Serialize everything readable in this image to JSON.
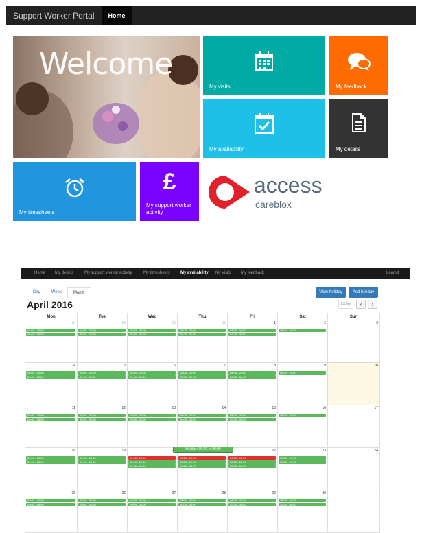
{
  "portal": {
    "brand": "Support Worker Portal",
    "nav_home": "Home",
    "welcome": "Welcome",
    "tiles": {
      "visits": "My visits",
      "feedback": "My feedback",
      "availability": "My availability",
      "details": "My details",
      "timesheets": "My timesheets",
      "activity": "My support worker activity"
    },
    "logo": {
      "name": "access",
      "sub": "careblox"
    },
    "colors": {
      "visits": "#00aaa5",
      "feedback": "#ff6b00",
      "availability": "#1ec0e8",
      "details": "#333333",
      "timesheets": "#2196df",
      "activity": "#7a00ff",
      "logo_red": "#e0202a"
    }
  },
  "calendar_app": {
    "nav": [
      "Home",
      "My details",
      "My support worker activity",
      "My timesheets",
      "My availability",
      "My visits",
      "My feedback"
    ],
    "nav_active": "My availability",
    "logout": "Logout",
    "view_tabs": [
      "Day",
      "Week",
      "Month"
    ],
    "active_view": "Month",
    "view_holiday": "View holiday",
    "add_holiday": "Add holiday",
    "title": "April 2016",
    "today_label": "today",
    "prev_icon": "‹",
    "next_icon": "›",
    "tooltip": "Holiday: 00:00 to 00:00",
    "day_headers": [
      "Mon",
      "Tue",
      "Wed",
      "Thu",
      "Fri",
      "Sat",
      "Sun"
    ],
    "weeks": [
      {
        "days": [
          {
            "n": "28",
            "other": true,
            "events": [
              {
                "t": "08:00 - 20:00",
                "c": "g"
              },
              {
                "t": "20:00 - 08:00",
                "c": "g"
              }
            ]
          },
          {
            "n": "29",
            "other": true,
            "events": [
              {
                "t": "08:00 - 20:00",
                "c": "g"
              },
              {
                "t": "20:00 - 08:00",
                "c": "g"
              }
            ]
          },
          {
            "n": "30",
            "other": true,
            "events": [
              {
                "t": "08:00 - 20:00",
                "c": "g"
              },
              {
                "t": "20:00 - 08:00",
                "c": "g"
              }
            ]
          },
          {
            "n": "31",
            "other": true,
            "events": [
              {
                "t": "08:00 - 20:00",
                "c": "g"
              },
              {
                "t": "20:00 - 08:00",
                "c": "g"
              }
            ]
          },
          {
            "n": "1",
            "events": [
              {
                "t": "08:00 - 20:00",
                "c": "g"
              },
              {
                "t": "20:00 - 08:00",
                "c": "g"
              }
            ]
          },
          {
            "n": "2",
            "events": [
              {
                "t": "08:00 - 20:00",
                "c": "g"
              }
            ]
          },
          {
            "n": "3",
            "events": []
          }
        ]
      },
      {
        "days": [
          {
            "n": "4",
            "events": [
              {
                "t": "08:00 - 20:00",
                "c": "g"
              },
              {
                "t": "20:00 - 08:00",
                "c": "g"
              }
            ]
          },
          {
            "n": "5",
            "events": [
              {
                "t": "08:00 - 20:00",
                "c": "g"
              },
              {
                "t": "20:00 - 08:00",
                "c": "g"
              }
            ]
          },
          {
            "n": "6",
            "events": [
              {
                "t": "08:00 - 20:00",
                "c": "g"
              },
              {
                "t": "20:00 - 08:00",
                "c": "g"
              }
            ]
          },
          {
            "n": "7",
            "events": [
              {
                "t": "08:00 - 20:00",
                "c": "g"
              },
              {
                "t": "20:00 - 08:00",
                "c": "g"
              }
            ]
          },
          {
            "n": "8",
            "events": [
              {
                "t": "08:00 - 20:00",
                "c": "g"
              },
              {
                "t": "20:00 - 08:00",
                "c": "g"
              }
            ]
          },
          {
            "n": "9",
            "events": [
              {
                "t": "08:00 - 20:00",
                "c": "g"
              }
            ]
          },
          {
            "n": "10",
            "today": true,
            "events": []
          }
        ]
      },
      {
        "days": [
          {
            "n": "11",
            "events": [
              {
                "t": "08:00 - 20:00",
                "c": "g"
              },
              {
                "t": "20:00 - 08:00",
                "c": "g"
              }
            ]
          },
          {
            "n": "12",
            "events": [
              {
                "t": "08:00 - 20:00",
                "c": "g"
              },
              {
                "t": "20:00 - 08:00",
                "c": "g"
              }
            ]
          },
          {
            "n": "13",
            "events": [
              {
                "t": "08:00 - 20:00",
                "c": "g"
              },
              {
                "t": "20:00 - 08:00",
                "c": "g"
              }
            ]
          },
          {
            "n": "14",
            "events": [
              {
                "t": "08:00 - 20:00",
                "c": "g"
              },
              {
                "t": "20:00 - 08:00",
                "c": "g"
              }
            ]
          },
          {
            "n": "15",
            "events": [
              {
                "t": "08:00 - 20:00",
                "c": "g"
              },
              {
                "t": "20:00 - 08:00",
                "c": "g"
              }
            ]
          },
          {
            "n": "16",
            "events": [
              {
                "t": "08:00 - 20:00",
                "c": "g"
              }
            ]
          },
          {
            "n": "17",
            "events": []
          }
        ]
      },
      {
        "days": [
          {
            "n": "18",
            "events": [
              {
                "t": "08:00 - 20:00",
                "c": "g"
              },
              {
                "t": "20:00 - 08:00",
                "c": "g"
              }
            ]
          },
          {
            "n": "19",
            "events": [
              {
                "t": "08:00 - 20:00",
                "c": "g"
              },
              {
                "t": "20:00 - 08:00",
                "c": "g"
              }
            ]
          },
          {
            "n": "20",
            "events": [
              {
                "t": "00:00 - 00:00",
                "c": "r"
              },
              {
                "t": "08:00 - 20:00",
                "c": "g"
              },
              {
                "t": "20:00 - 08:00",
                "c": "g"
              }
            ]
          },
          {
            "n": "21",
            "events": [
              {
                "t": "00:00 - 00:00",
                "c": "r"
              },
              {
                "t": "08:00 - 20:00",
                "c": "g"
              },
              {
                "t": "20:00 - 08:00",
                "c": "g"
              }
            ]
          },
          {
            "n": "22",
            "events": [
              {
                "t": "00:00 - 00:00",
                "c": "r"
              },
              {
                "t": "08:00 - 20:00",
                "c": "g"
              },
              {
                "t": "20:00 - 08:00",
                "c": "g"
              }
            ]
          },
          {
            "n": "23",
            "events": [
              {
                "t": "08:00 - 20:00",
                "c": "g"
              },
              {
                "t": "20:00 - 08:00",
                "c": "g"
              }
            ]
          },
          {
            "n": "24",
            "events": []
          }
        ]
      },
      {
        "days": [
          {
            "n": "25",
            "events": [
              {
                "t": "08:00 - 20:00",
                "c": "g"
              },
              {
                "t": "20:00 - 08:00",
                "c": "g"
              }
            ]
          },
          {
            "n": "26",
            "events": [
              {
                "t": "08:00 - 20:00",
                "c": "g"
              },
              {
                "t": "20:00 - 08:00",
                "c": "g"
              }
            ]
          },
          {
            "n": "27",
            "events": [
              {
                "t": "08:00 - 20:00",
                "c": "g"
              },
              {
                "t": "20:00 - 08:00",
                "c": "g"
              }
            ]
          },
          {
            "n": "28",
            "events": [
              {
                "t": "08:00 - 20:00",
                "c": "g"
              },
              {
                "t": "20:00 - 08:00",
                "c": "g"
              }
            ]
          },
          {
            "n": "29",
            "events": [
              {
                "t": "08:00 - 20:00",
                "c": "g"
              },
              {
                "t": "20:00 - 08:00",
                "c": "g"
              }
            ]
          },
          {
            "n": "30",
            "events": [
              {
                "t": "08:00 - 20:00",
                "c": "g"
              },
              {
                "t": "20:00 - 08:00",
                "c": "g"
              }
            ]
          },
          {
            "n": "1",
            "other": true,
            "events": []
          }
        ]
      }
    ],
    "colors": {
      "event": "#5cb85c",
      "holiday_event": "#e03030",
      "today_bg": "#fcf8e3",
      "nav_bg": "#1a1a1a",
      "button": "#337ab7"
    }
  }
}
